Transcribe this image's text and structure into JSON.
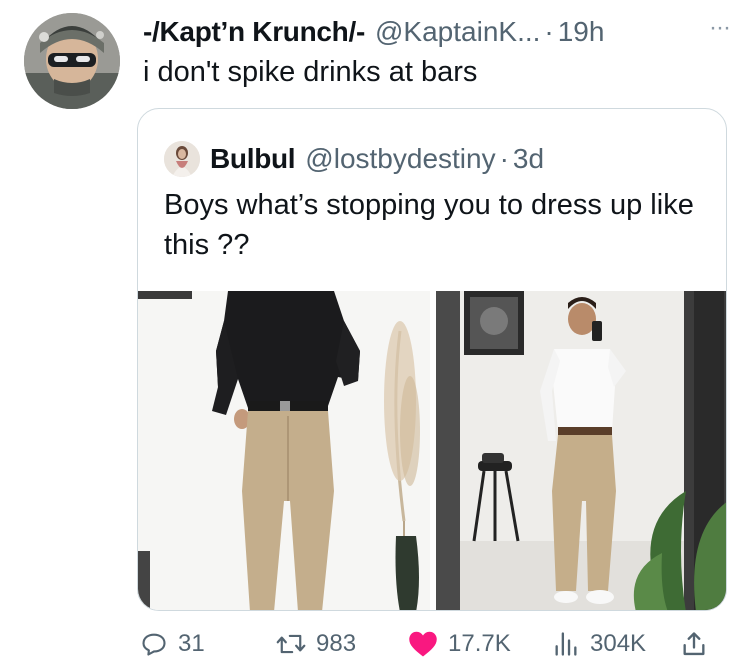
{
  "tweet": {
    "author_name": "-/Kapt’n Krunch/-",
    "author_handle": "@KaptainK...",
    "separator": "·",
    "timestamp": "19h",
    "more_label": "···",
    "text": "i don't spike drinks at bars"
  },
  "quoted_tweet": {
    "author_name": "Bulbul",
    "author_handle": "@lostbydestiny",
    "separator": "·",
    "timestamp": "3d",
    "text": "Boys what’s stopping you to dress up like this ??"
  },
  "actions": {
    "replies": "31",
    "retweets": "983",
    "likes": "17.7K",
    "views": "304K"
  },
  "colors": {
    "text_primary": "#0f1419",
    "text_secondary": "#536471",
    "border": "#cfd9de",
    "like_active": "#f91880"
  },
  "icons": [
    "reply-icon",
    "retweet-icon",
    "heart-icon",
    "views-icon",
    "share-icon",
    "more-icon"
  ]
}
